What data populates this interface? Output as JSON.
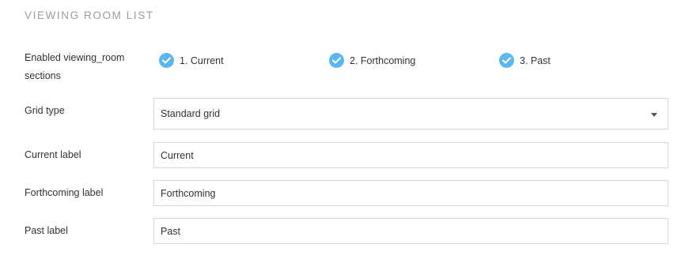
{
  "section": {
    "title": "VIEWING ROOM LIST"
  },
  "sections_setting": {
    "label_line1": "Enabled viewing_room",
    "label_line2": "sections",
    "options": [
      {
        "label": "1. Current",
        "checked": true
      },
      {
        "label": "2. Forthcoming",
        "checked": true
      },
      {
        "label": "3. Past",
        "checked": true
      }
    ]
  },
  "grid_type": {
    "label": "Grid type",
    "selected": "Standard grid"
  },
  "current_label": {
    "label": "Current label",
    "value": "Current"
  },
  "forthcoming_label": {
    "label": "Forthcoming label",
    "value": "Forthcoming"
  },
  "past_label": {
    "label": "Past label",
    "value": "Past"
  },
  "colors": {
    "accent": "#5bb6f2",
    "muted_text": "#9b9b9b",
    "border": "#d9d9d9"
  }
}
